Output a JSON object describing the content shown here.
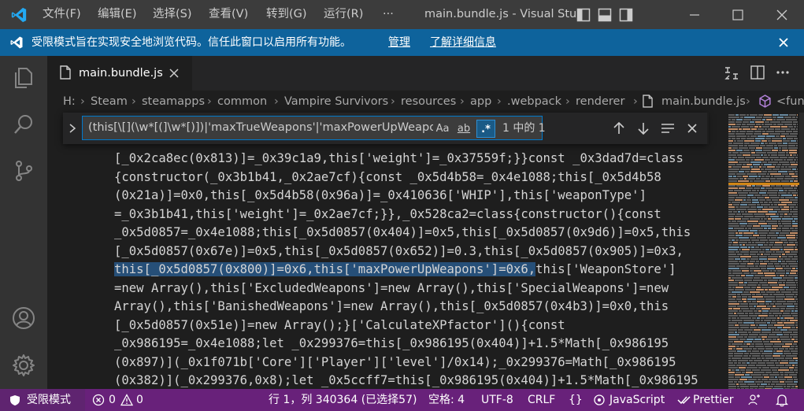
{
  "titlebar": {
    "menu": [
      "文件(F)",
      "编辑(E)",
      "选择(S)",
      "查看(V)",
      "转到(G)",
      "运行(R)",
      "···"
    ],
    "window_title": "main.bundle.js - Visual Stu"
  },
  "banner": {
    "message": "受限模式旨在实现安全地浏览代码。信任此窗口以启用所有功能。",
    "manage": "管理",
    "learn_more": "了解详细信息"
  },
  "tab": {
    "label": "main.bundle.js"
  },
  "breadcrumbs": [
    "H:",
    "Steam",
    "steamapps",
    "common",
    "Vampire Survivors",
    "resources",
    "app",
    ".webpack",
    "renderer",
    "main.bundle.js",
    "<fun"
  ],
  "find": {
    "query": "(this[\\[](\\w*[(]\\w*[)])|'maxTrueWeapons'|'maxPowerUpWeapons",
    "opt_case": "Aa",
    "opt_word": "ab",
    "opt_regex": ".*",
    "result": "1 中的 1"
  },
  "code": {
    "lines": [
      "[_0x2ca8ec(0x813)]=_0x39c1a9,this['weight']=_0x37559f;}}const _0x3dad7d=class",
      "{constructor(_0x3b1b41,_0x2ae7cf){const _0x5d4b58=_0x4e1088;this[_0x5d4b58",
      "(0x21a)]=0x0,this[_0x5d4b58(0x96a)]=_0x410636['WHIP'],this['weaponType']",
      "=_0x3b1b41,this['weight']=_0x2ae7cf;}},_0x528ca2=class{constructor(){const",
      "_0x5d0857=_0x4e1088;this[_0x5d0857(0x404)]=0x5,this[_0x5d0857(0x9d6)]=0x5,this",
      "[_0x5d0857(0x67e)]=0x5,this[_0x5d0857(0x652)]=0.3,this[_0x5d0857(0x905)]=0x3,"
    ],
    "sel_part": "this[_0x5d0857(0x800)]=0x6,this['maxPowerUpWeapons']=0x6,",
    "sel_rest": "this['WeaponStore']",
    "lines2": [
      "=new Array(),this['ExcludedWeapons']=new Array(),this['SpecialWeapons']=new",
      "Array(),this['BanishedWeapons']=new Array(),this[_0x5d0857(0x4b3)]=0x0,this",
      "[_0x5d0857(0x51e)]=new Array();}['CalculateXPfactor'](){const",
      "_0x986195=_0x4e1088;let _0x299376=this[_0x986195(0x404)]+1.5*Math[_0x986195",
      "(0x897)](_0x1f071b['Core']['Player']['level']/0x14);_0x299376=Math[_0x986195",
      "(0x382)](_0x299376,0x8);let _0x5ccff7=this[_0x986195(0x404)]+1.5*Math[_0x986195"
    ]
  },
  "status": {
    "mode": "受限模式",
    "errors": "0",
    "warnings": "0",
    "position": "行 1，列 340364 (已选择57)",
    "spaces": "空格: 4",
    "encoding": "UTF-8",
    "eol": "CRLF",
    "braces": "{}",
    "language": "JavaScript",
    "prettier": "Prettier"
  },
  "colors": {
    "titlebar": "#3c3c3c",
    "banner": "#0e639c",
    "statusbar": "#68217a",
    "editor": "#1e1e1e"
  }
}
